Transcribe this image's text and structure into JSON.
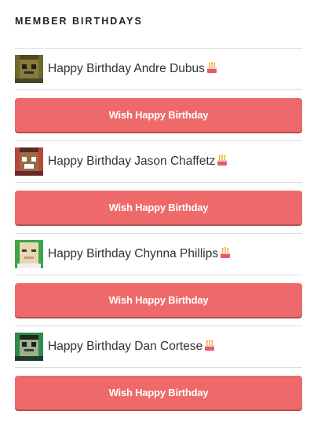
{
  "widget": {
    "title": "MEMBER BIRTHDAYS"
  },
  "button_label": "Wish Happy Birthday",
  "colors": {
    "accent": "#ee6a6a",
    "rule": "#dddddd"
  },
  "members": [
    {
      "message": "Happy Birthday Andre Dubus",
      "avatar": "pixel-avatar",
      "icon": "birthday-cake-icon"
    },
    {
      "message": "Happy Birthday Jason Chaffetz",
      "avatar": "pixel-avatar",
      "icon": "birthday-cake-icon"
    },
    {
      "message": "Happy Birthday Chynna Phillips",
      "avatar": "pixel-avatar",
      "icon": "birthday-cake-icon"
    },
    {
      "message": "Happy Birthday Dan Cortese",
      "avatar": "pixel-avatar",
      "icon": "birthday-cake-icon"
    }
  ]
}
